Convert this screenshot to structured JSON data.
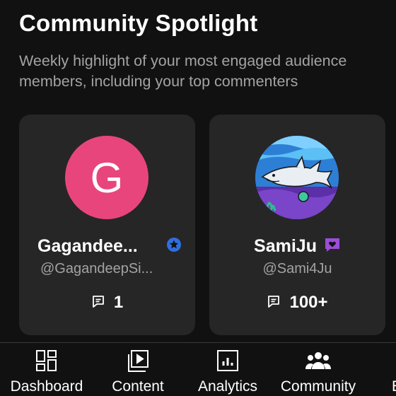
{
  "header": {
    "title": "Community Spotlight",
    "subtitle": "Weekly highlight of your most engaged audience members, including your top commenters"
  },
  "cards": [
    {
      "avatar_letter": "G",
      "avatar_color": "#e8457d",
      "name": "Gagandee...",
      "badge_icon": "star-badge-icon",
      "badge_color": "#2f6fdd",
      "handle": "@GagandeepSi...",
      "comment_count": "1"
    },
    {
      "avatar_image": "shark-illustration",
      "name": "SamiJu",
      "badge_icon": "heart-badge-icon",
      "badge_color": "#9b4dd8",
      "handle": "@Sami4Ju",
      "comment_count": "100+"
    }
  ],
  "nav": {
    "items": [
      {
        "label": "Dashboard",
        "icon": "dashboard-icon"
      },
      {
        "label": "Content",
        "icon": "content-icon"
      },
      {
        "label": "Analytics",
        "icon": "analytics-icon"
      },
      {
        "label": "Community",
        "icon": "community-icon"
      },
      {
        "label": "E",
        "icon": "earn-icon"
      }
    ]
  }
}
